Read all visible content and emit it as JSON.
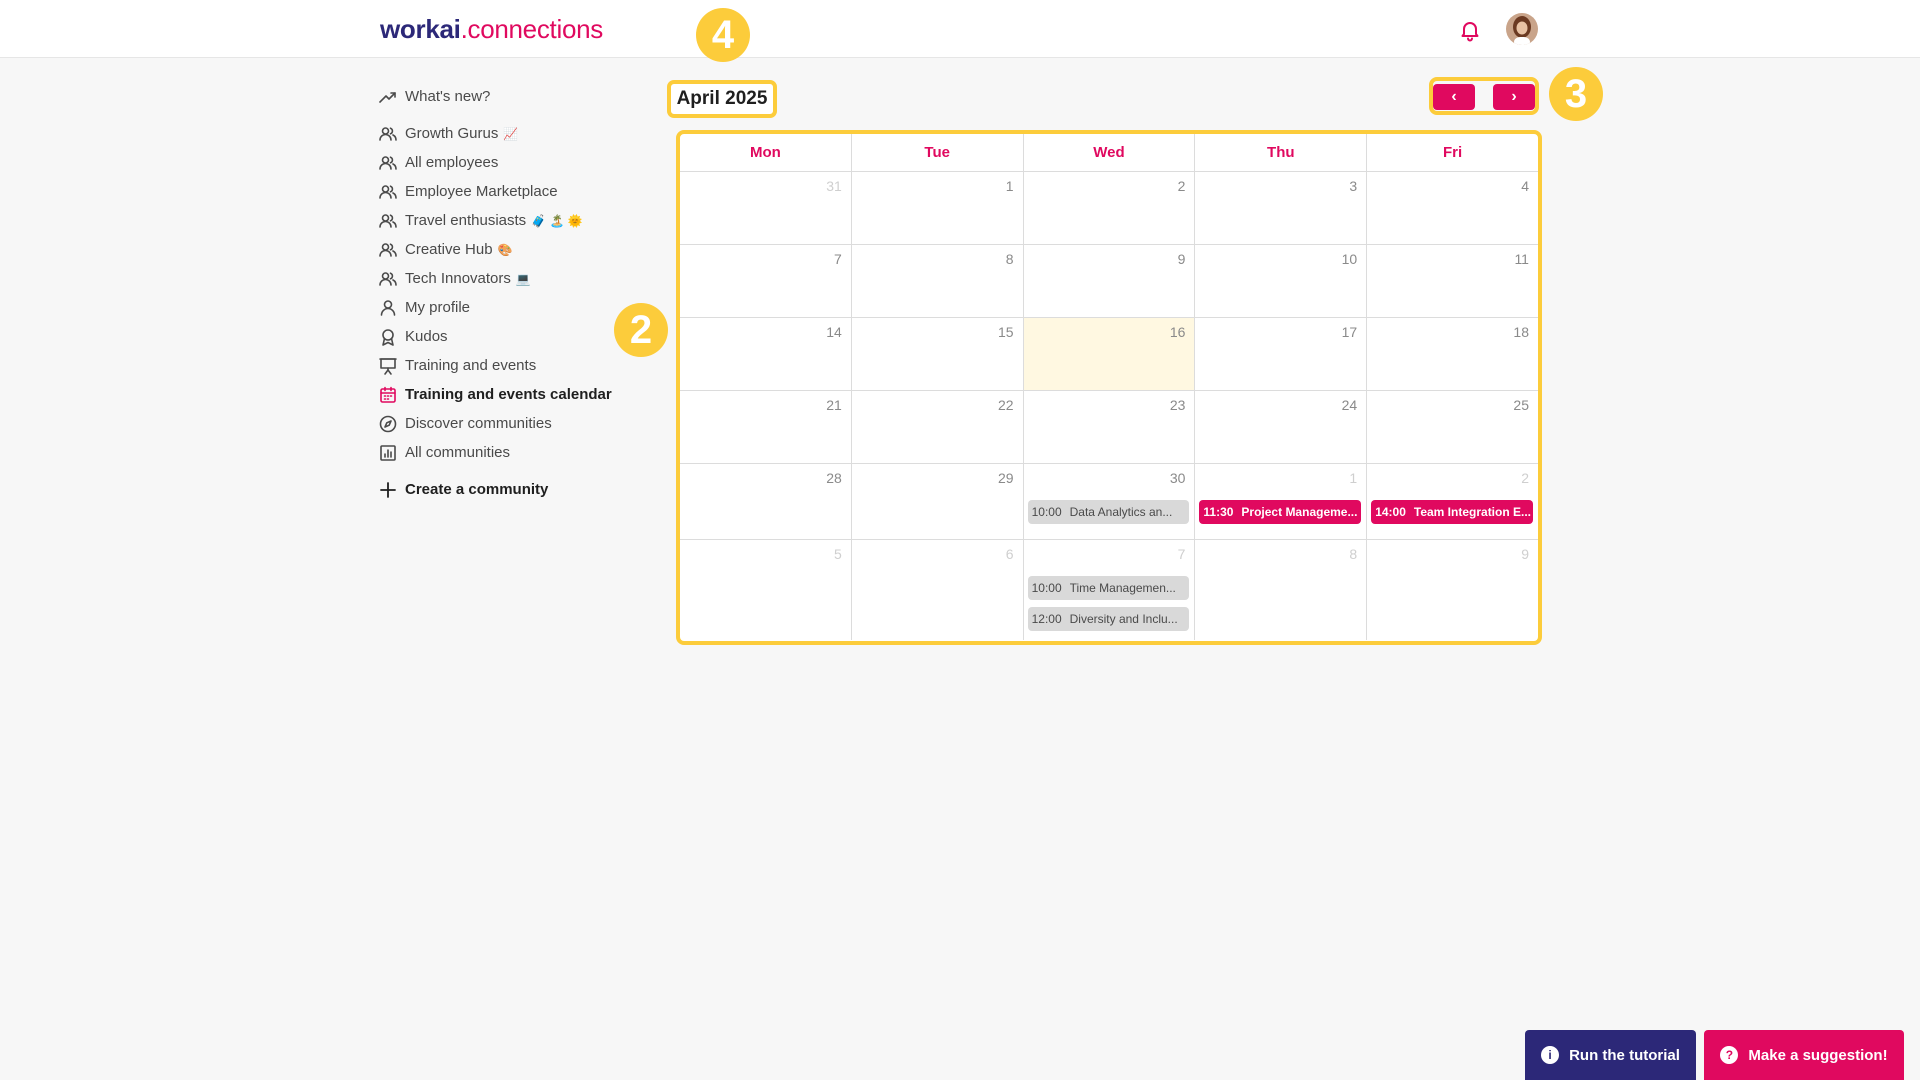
{
  "header": {
    "logo_part1": "workai",
    "logo_part2": ".connections"
  },
  "colors": {
    "brand_pink": "#e0095f",
    "brand_navy": "#2c2878",
    "highlight": "#fccc3b"
  },
  "sidebar": {
    "items": [
      {
        "label": "What's new?",
        "icon": "trend-icon",
        "emoji": ""
      },
      {
        "label": "Growth Gurus",
        "icon": "users-icon",
        "emoji": "📈"
      },
      {
        "label": "All employees",
        "icon": "users-icon",
        "emoji": ""
      },
      {
        "label": "Employee Marketplace",
        "icon": "users-icon",
        "emoji": ""
      },
      {
        "label": "Travel enthusiasts",
        "icon": "users-icon",
        "emoji": "🧳 🏝️ 🌞"
      },
      {
        "label": "Creative Hub",
        "icon": "users-icon",
        "emoji": "🎨"
      },
      {
        "label": "Tech Innovators",
        "icon": "users-icon",
        "emoji": "💻"
      },
      {
        "label": "My profile",
        "icon": "user-icon",
        "emoji": ""
      },
      {
        "label": "Kudos",
        "icon": "award-icon",
        "emoji": ""
      },
      {
        "label": "Training and events",
        "icon": "presentation-icon",
        "emoji": ""
      },
      {
        "label": "Training and events calendar",
        "icon": "calendar-icon",
        "emoji": ""
      },
      {
        "label": "Discover communities",
        "icon": "compass-icon",
        "emoji": ""
      },
      {
        "label": "All communities",
        "icon": "chart-icon",
        "emoji": ""
      }
    ],
    "create_label": "Create a community"
  },
  "tutorial_steps": {
    "step2": "2",
    "step3": "3",
    "step4": "4"
  },
  "calendar": {
    "month_title": "April 2025",
    "prev_label": "‹",
    "next_label": "›",
    "weekdays": [
      "Mon",
      "Tue",
      "Wed",
      "Thu",
      "Fri"
    ],
    "weeks": [
      {
        "height": 73,
        "days": [
          {
            "n": "31",
            "other": true
          },
          {
            "n": "1"
          },
          {
            "n": "2"
          },
          {
            "n": "3"
          },
          {
            "n": "4"
          }
        ]
      },
      {
        "height": 73,
        "days": [
          {
            "n": "7"
          },
          {
            "n": "8"
          },
          {
            "n": "9"
          },
          {
            "n": "10"
          },
          {
            "n": "11"
          }
        ]
      },
      {
        "height": 73,
        "days": [
          {
            "n": "14"
          },
          {
            "n": "15"
          },
          {
            "n": "16",
            "today": true
          },
          {
            "n": "17"
          },
          {
            "n": "18"
          }
        ]
      },
      {
        "height": 73,
        "days": [
          {
            "n": "21"
          },
          {
            "n": "22"
          },
          {
            "n": "23"
          },
          {
            "n": "24"
          },
          {
            "n": "25"
          }
        ]
      },
      {
        "height": 76,
        "days": [
          {
            "n": "28"
          },
          {
            "n": "29"
          },
          {
            "n": "30",
            "events": [
              {
                "time": "10:00",
                "title": "Data Analytics an...",
                "style": "grey"
              }
            ]
          },
          {
            "n": "1",
            "other": true,
            "events": [
              {
                "time": "11:30",
                "title": "Project Manageme...",
                "style": "pink"
              }
            ]
          },
          {
            "n": "2",
            "other": true,
            "events": [
              {
                "time": "14:00",
                "title": "Team Integration E...",
                "style": "pink"
              }
            ]
          }
        ]
      },
      {
        "height": 100,
        "days": [
          {
            "n": "5",
            "other": true
          },
          {
            "n": "6",
            "other": true
          },
          {
            "n": "7",
            "other": true,
            "events": [
              {
                "time": "10:00",
                "title": "Time Managemen...",
                "style": "grey"
              },
              {
                "time": "12:00",
                "title": "Diversity and Inclu...",
                "style": "grey"
              }
            ]
          },
          {
            "n": "8",
            "other": true
          },
          {
            "n": "9",
            "other": true
          }
        ]
      }
    ]
  },
  "bottom": {
    "tutorial_label": "Run the tutorial",
    "suggestion_label": "Make a suggestion!"
  }
}
